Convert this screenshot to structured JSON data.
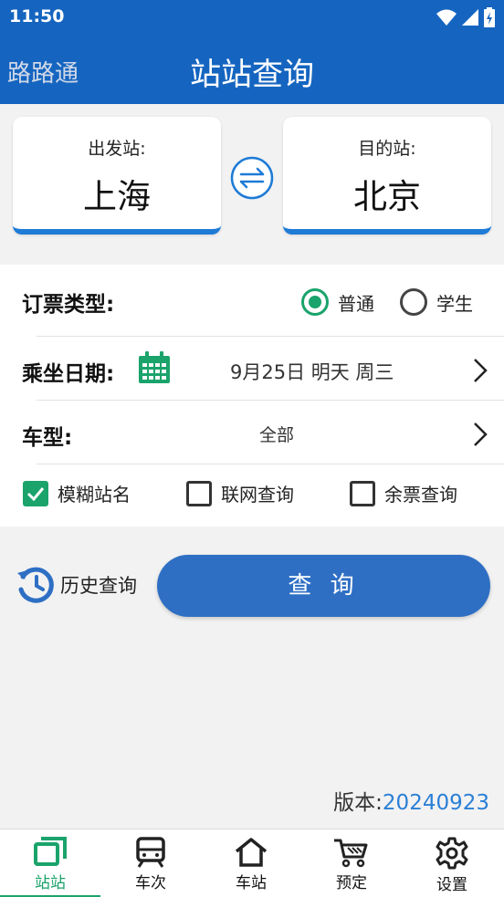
{
  "status_bar": {
    "time": "11:50"
  },
  "app_bar": {
    "left_label": "路路通",
    "title": "站站查询"
  },
  "stations": {
    "from": {
      "label": "出发站:",
      "city": "上海"
    },
    "to": {
      "label": "目的站:",
      "city": "北京"
    }
  },
  "ticket_type": {
    "label": "订票类型:",
    "options": [
      {
        "label": "普通",
        "selected": true
      },
      {
        "label": "学生",
        "selected": false
      }
    ]
  },
  "date": {
    "label": "乘坐日期:",
    "value": "9月25日 明天 周三"
  },
  "train_type": {
    "label": "车型:",
    "value": "全部"
  },
  "options": [
    {
      "label": "模糊站名",
      "checked": true
    },
    {
      "label": "联网查询",
      "checked": false
    },
    {
      "label": "余票查询",
      "checked": false
    }
  ],
  "history_label": "历史查询",
  "query_button": "查 询",
  "version": {
    "label": "版本:",
    "number": "20240923"
  },
  "tabs": [
    {
      "label": "站站",
      "icon": "station-to-station-icon",
      "active": true
    },
    {
      "label": "车次",
      "icon": "train-icon",
      "active": false
    },
    {
      "label": "车站",
      "icon": "home-icon",
      "active": false
    },
    {
      "label": "预定",
      "icon": "cart-icon",
      "active": false
    },
    {
      "label": "设置",
      "icon": "gear-icon",
      "active": false
    }
  ],
  "colors": {
    "primary": "#1565c0",
    "accent": "#1aa36b",
    "button": "#2e6fc4",
    "version_number": "#2b7fd6"
  }
}
